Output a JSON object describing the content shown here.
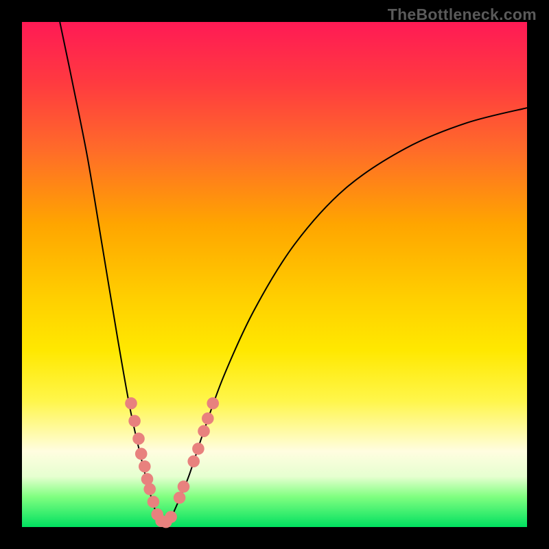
{
  "watermark": "TheBottleneck.com",
  "chart_data": {
    "type": "line",
    "title": "",
    "xlabel": "",
    "ylabel": "",
    "xlim": [
      0,
      1
    ],
    "ylim": [
      0,
      1
    ],
    "background_gradient": [
      "#ff1a55",
      "#ff6a2a",
      "#ffd000",
      "#fff64a",
      "#fffde0",
      "#00e060"
    ],
    "curve": {
      "description": "V-shaped bottleneck curve with minimum near x≈0.28",
      "points": [
        {
          "x": 0.075,
          "y": 1.0
        },
        {
          "x": 0.1,
          "y": 0.88
        },
        {
          "x": 0.13,
          "y": 0.73
        },
        {
          "x": 0.16,
          "y": 0.55
        },
        {
          "x": 0.19,
          "y": 0.37
        },
        {
          "x": 0.215,
          "y": 0.23
        },
        {
          "x": 0.24,
          "y": 0.12
        },
        {
          "x": 0.26,
          "y": 0.045
        },
        {
          "x": 0.275,
          "y": 0.01
        },
        {
          "x": 0.29,
          "y": 0.01
        },
        {
          "x": 0.305,
          "y": 0.04
        },
        {
          "x": 0.33,
          "y": 0.1
        },
        {
          "x": 0.36,
          "y": 0.19
        },
        {
          "x": 0.4,
          "y": 0.3
        },
        {
          "x": 0.46,
          "y": 0.43
        },
        {
          "x": 0.54,
          "y": 0.56
        },
        {
          "x": 0.64,
          "y": 0.67
        },
        {
          "x": 0.76,
          "y": 0.75
        },
        {
          "x": 0.88,
          "y": 0.8
        },
        {
          "x": 1.0,
          "y": 0.83
        }
      ]
    },
    "markers": {
      "color": "#e8817e",
      "radius_frac": 0.012,
      "points": [
        {
          "x": 0.216,
          "y": 0.245
        },
        {
          "x": 0.223,
          "y": 0.21
        },
        {
          "x": 0.231,
          "y": 0.175
        },
        {
          "x": 0.236,
          "y": 0.145
        },
        {
          "x": 0.243,
          "y": 0.12
        },
        {
          "x": 0.248,
          "y": 0.095
        },
        {
          "x": 0.253,
          "y": 0.075
        },
        {
          "x": 0.26,
          "y": 0.05
        },
        {
          "x": 0.268,
          "y": 0.025
        },
        {
          "x": 0.276,
          "y": 0.012
        },
        {
          "x": 0.285,
          "y": 0.01
        },
        {
          "x": 0.295,
          "y": 0.02
        },
        {
          "x": 0.312,
          "y": 0.058
        },
        {
          "x": 0.32,
          "y": 0.08
        },
        {
          "x": 0.34,
          "y": 0.13
        },
        {
          "x": 0.349,
          "y": 0.155
        },
        {
          "x": 0.36,
          "y": 0.19
        },
        {
          "x": 0.368,
          "y": 0.215
        },
        {
          "x": 0.378,
          "y": 0.245
        }
      ]
    }
  }
}
